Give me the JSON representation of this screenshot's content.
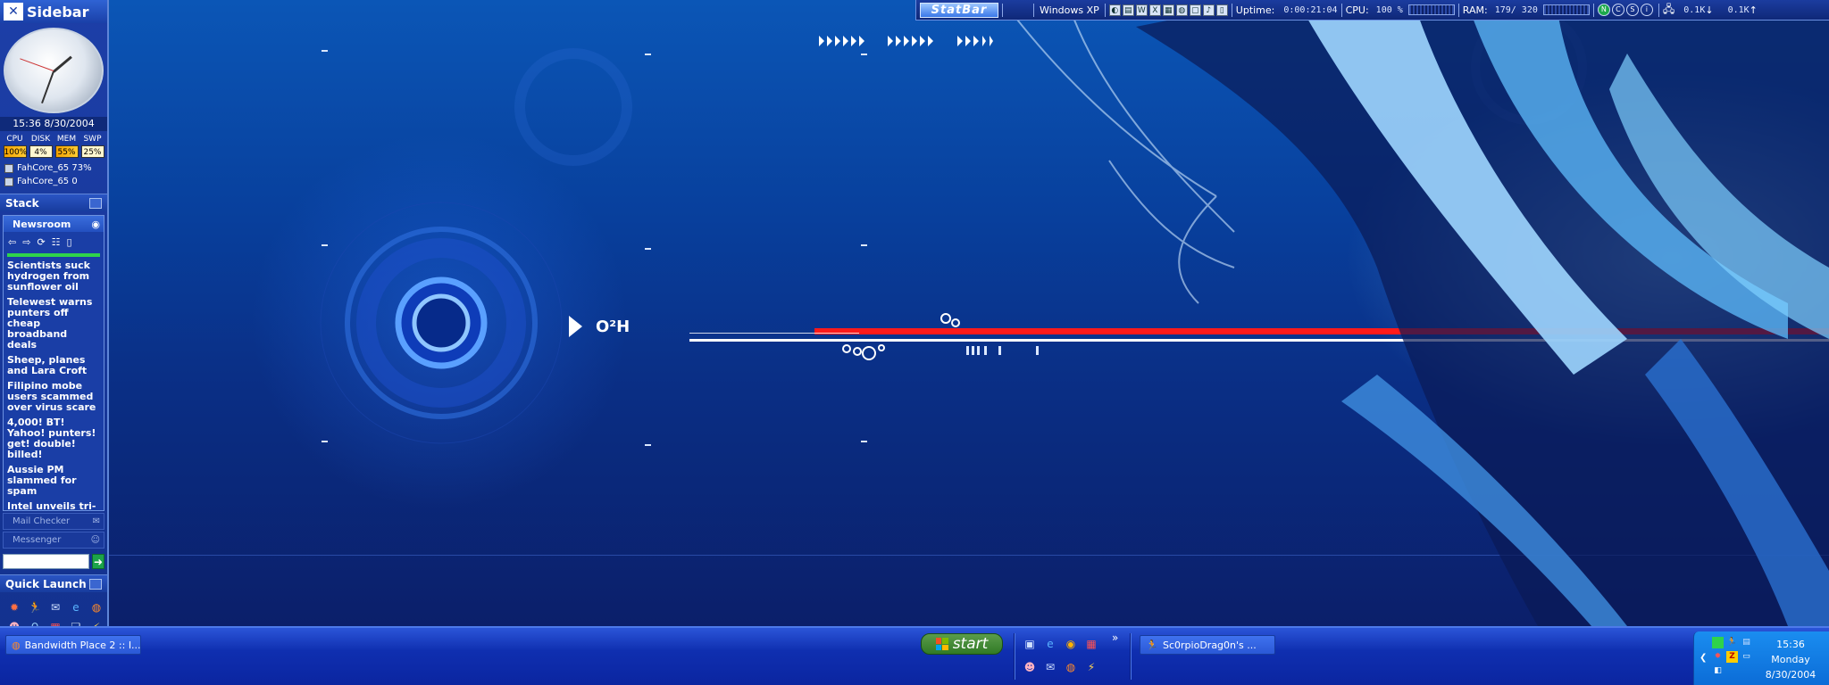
{
  "sidebar": {
    "title": "Sidebar",
    "datetime": "15:36 8/30/2004",
    "meters": [
      {
        "label": "CPU",
        "value": "100%"
      },
      {
        "label": "DISK",
        "value": "4%"
      },
      {
        "label": "MEM",
        "value": "55%"
      },
      {
        "label": "SWP",
        "value": "25%"
      }
    ],
    "processes": [
      "FahCore_65 73%",
      "FahCore_65 0"
    ],
    "stack_title": "Stack",
    "newsroom": {
      "title": "Newsroom",
      "headlines": [
        "Scientists suck hydrogen from sunflower oil",
        "Telewest warns punters off cheap broadband deals",
        "Sheep, planes and Lara Croft",
        "Filipino mobe users scammed over virus scare",
        "4,000! BT! Yahoo! punters! get! double! billed!",
        "Aussie PM slammed for spam",
        "Intel unveils tri-"
      ]
    },
    "mail_checker": "Mail Checker",
    "messenger": "Messenger",
    "search_value": "",
    "quick_launch_title": "Quick Launch"
  },
  "statbar": {
    "logo": "StatBar",
    "os": "Windows XP",
    "uptime_label": "Uptime:",
    "uptime_value": "0:00:21:04",
    "cpu_label": "CPU:",
    "cpu_value": "100 %",
    "ram_label": "RAM:",
    "ram_value": "179/ 320",
    "net_down": "0.1K",
    "net_up": "0.1K"
  },
  "wallpaper": {
    "logo_text": "O²H"
  },
  "taskbar": {
    "window1_label": "Bandwidth Place 2 :: I...",
    "start_label": "start",
    "window2_label": "Sc0rpioDrag0n's ...",
    "more_label": "»"
  },
  "tray": {
    "time": "15:36",
    "day": "Monday",
    "date": "8/30/2004"
  },
  "colors": {
    "accent_red": "#ff1a1a",
    "taskbar_blue": "#0f2fb0",
    "tray_blue": "#0b6bd6",
    "start_green": "#317a26"
  }
}
